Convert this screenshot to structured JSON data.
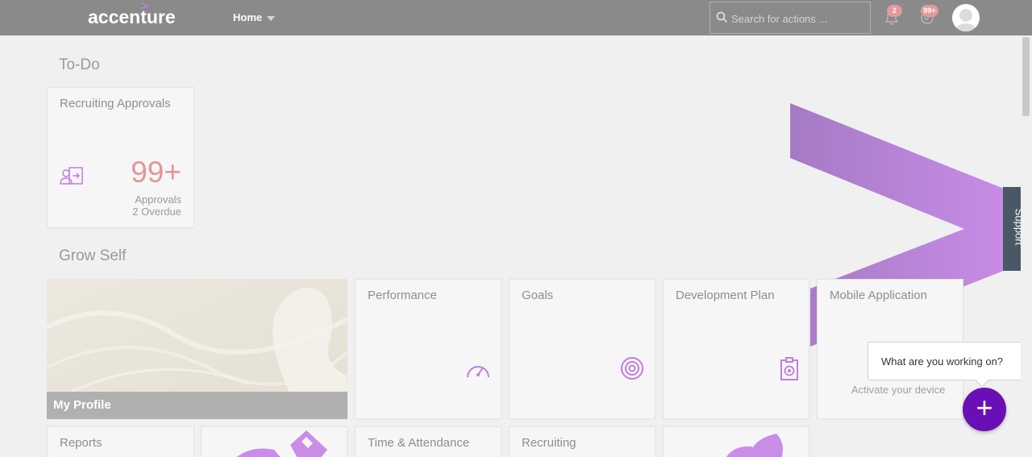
{
  "header": {
    "logo_text": "accenture",
    "logo_mark": ">",
    "home_label": "Home",
    "search_placeholder": "Search for actions ...",
    "notifications_badge": "2",
    "tasks_badge": "99+"
  },
  "todo": {
    "section_title": "To-Do",
    "tiles": [
      {
        "title": "Recruiting Approvals",
        "icon": "user-approval-icon",
        "value": "99+",
        "unit": "Approvals",
        "subtext": "2 Overdue"
      }
    ]
  },
  "grow_self": {
    "section_title": "Grow Self",
    "profile_label": "My Profile",
    "tiles": [
      {
        "title": "Performance",
        "icon": "speedometer-icon"
      },
      {
        "title": "Goals",
        "icon": "target-icon"
      },
      {
        "title": "Development Plan",
        "icon": "clipboard-target-icon"
      },
      {
        "title": "Mobile Application",
        "footer": "Activate your device"
      }
    ]
  },
  "row3": {
    "tiles": [
      {
        "title": "Reports"
      },
      {
        "title": "Time & Attendance"
      },
      {
        "title": "Recruiting"
      }
    ]
  },
  "support_label": "Support",
  "chat_bubble": "What are you working on?",
  "fab_label": "+",
  "colors": {
    "accent_purple": "#a100ff",
    "header_gray": "#8a8a8a",
    "kpi_pink": "#e2979a",
    "fab_purple": "#6a0fb5"
  }
}
